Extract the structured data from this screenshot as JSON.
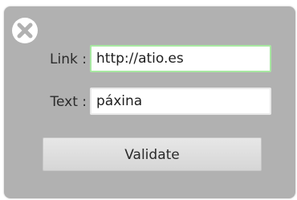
{
  "dialog": {
    "close_icon": "close-x-circle-icon",
    "link_label": "Link :",
    "link_value": "http://atio.es",
    "text_label": "Text :",
    "text_value": "páxina",
    "validate_label": "Validate"
  },
  "colors": {
    "dialog_bg": "#b1b1b1",
    "focus_border": "#a8e8a2",
    "button_bg": "#e0e0e0"
  }
}
